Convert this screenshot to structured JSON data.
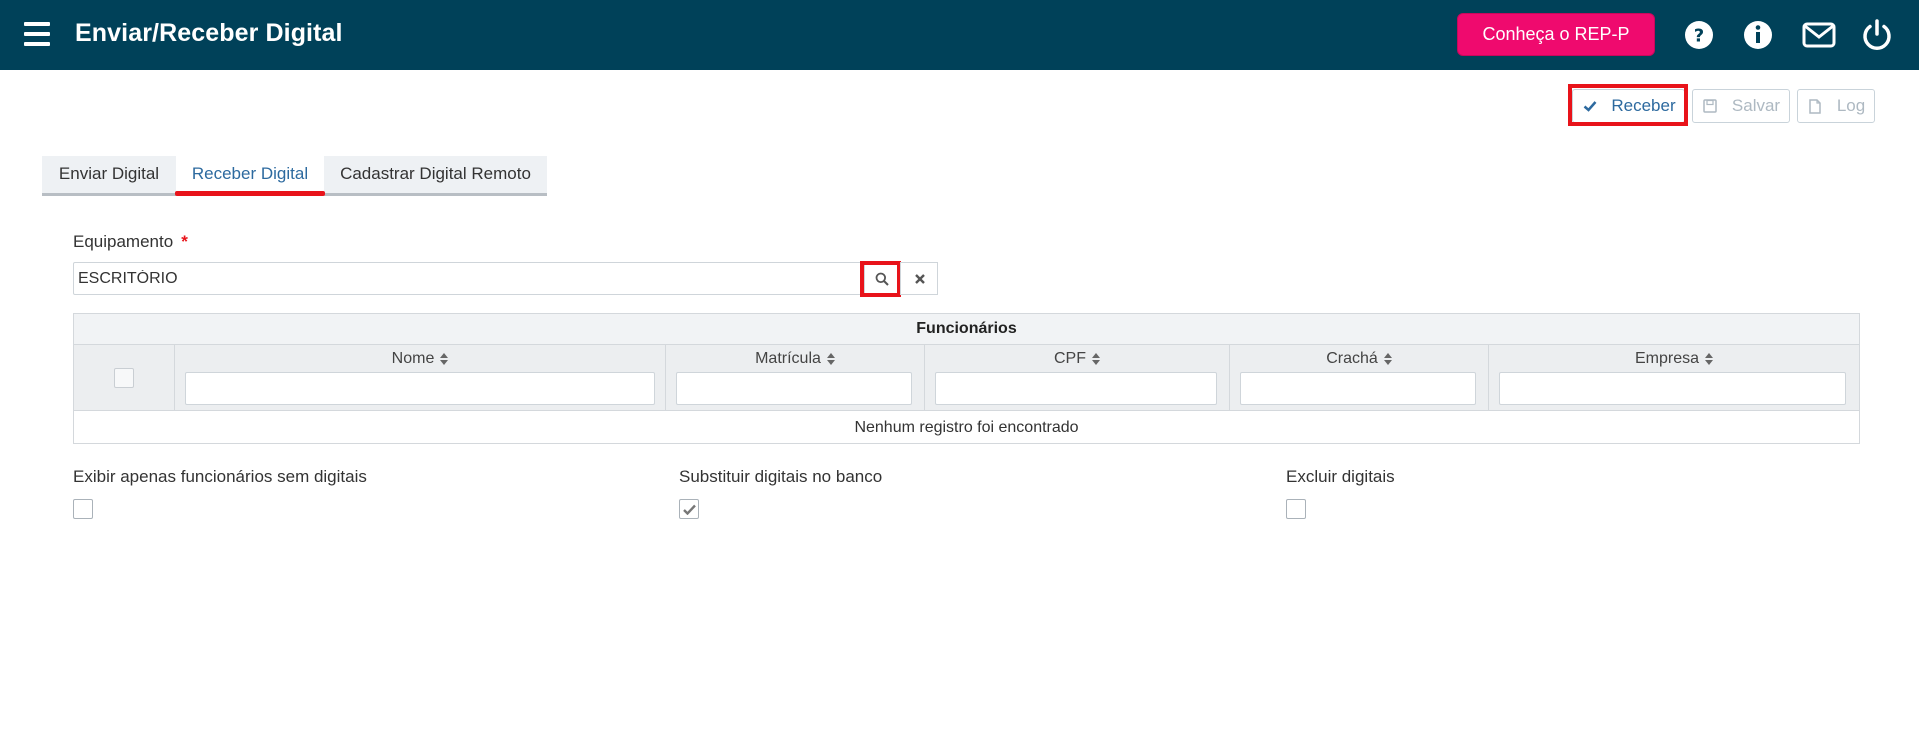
{
  "header": {
    "title": "Enviar/Receber Digital",
    "promo_label": "Conheça o REP-P",
    "icons": [
      "menu-icon",
      "help-icon",
      "info-icon",
      "mail-icon",
      "power-icon"
    ],
    "background_color": "#004159",
    "promo_color": "#ef0a6e"
  },
  "toolbar": {
    "receber_label": "Receber",
    "salvar_label": "Salvar",
    "log_label": "Log"
  },
  "tabs": [
    {
      "label": "Enviar Digital",
      "active": false
    },
    {
      "label": "Receber Digital",
      "active": true
    },
    {
      "label": "Cadastrar Digital Remoto",
      "active": false
    }
  ],
  "equipamento": {
    "label": "Equipamento",
    "required_mark": "*",
    "value": "ESCRITÓRIO"
  },
  "grid": {
    "caption": "Funcionários",
    "columns": [
      "Nome",
      "Matrícula",
      "CPF",
      "Crachá",
      "Empresa"
    ],
    "empty_message": "Nenhum registro foi encontrado"
  },
  "options": [
    {
      "label": "Exibir apenas funcionários sem digitais",
      "checked": false
    },
    {
      "label": "Substituir digitais no banco",
      "checked": true
    },
    {
      "label": "Excluir digitais",
      "checked": false
    }
  ],
  "colors": {
    "highlight": "#e8131a",
    "link_blue": "#2d6a9f"
  }
}
